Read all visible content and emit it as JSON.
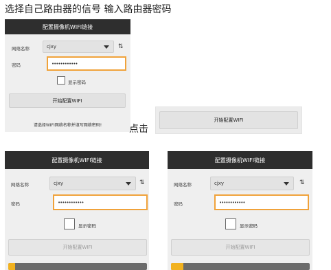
{
  "captions": {
    "top": "选择自己路由器的信号  输入路由器密码",
    "click": "点击"
  },
  "panel_main": {
    "title": "配置摄像机WIFI链接",
    "network_label": "网络名称",
    "network_value": "cjxy",
    "password_label": "密码",
    "password_value": "••••••••••••",
    "show_password_label": "显示密码",
    "start_button": "开始配置WIFI",
    "hint": "请选择WIFI网络名称并填写网络密码!"
  },
  "standalone": {
    "button": "开始配置WIFI"
  },
  "panel_left": {
    "title": "配置摄像机WIFI链接",
    "network_label": "网络名称",
    "network_value": "cjxy",
    "password_label": "密码",
    "password_value": "••••••••••••",
    "show_password_label": "显示密码",
    "start_button": "开始配置WIFI",
    "progress": 0.05
  },
  "panel_right": {
    "title": "配置摄像机WIFI链接",
    "network_label": "网络名称",
    "network_value": "cjxy",
    "password_label": "密码",
    "password_value": "••••••••••••",
    "show_password_label": "显示密码",
    "start_button": "开始配置WIFI",
    "progress": 0.09
  },
  "colors": {
    "accent": "#f0a23a",
    "titlebar": "#2e2e2e",
    "progress_fill": "#f2b21f"
  },
  "icons": {
    "dropdown": "chevron-down-icon",
    "swap": "refresh-icon"
  }
}
